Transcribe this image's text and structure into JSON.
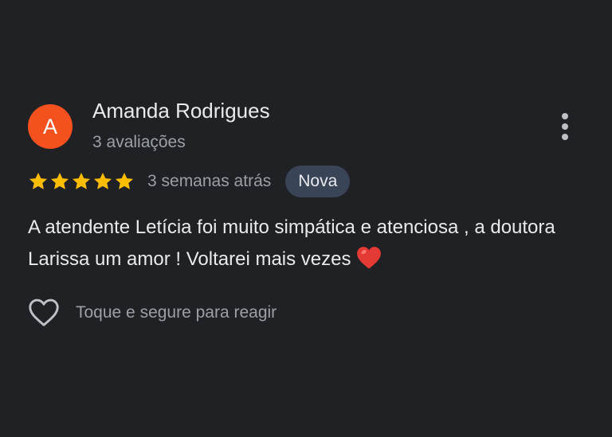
{
  "reviewer": {
    "initial": "A",
    "name": "Amanda Rodrigues",
    "review_count": "3 avaliações",
    "avatar_color": "#f4511e"
  },
  "review": {
    "rating": 5,
    "max_rating": 5,
    "star_color": "#fbbc04",
    "date": "3 semanas atrás",
    "badge": "Nova",
    "text": "A atendente Letícia foi muito simpática e atenciosa , a doutora Larissa um amor ! Voltarei mais vezes",
    "emoji": "red-heart-emoji"
  },
  "actions": {
    "more_icon": "more-vert-icon",
    "react_icon": "heart-outline-icon",
    "react_label": "Toque e segure para reagir"
  }
}
